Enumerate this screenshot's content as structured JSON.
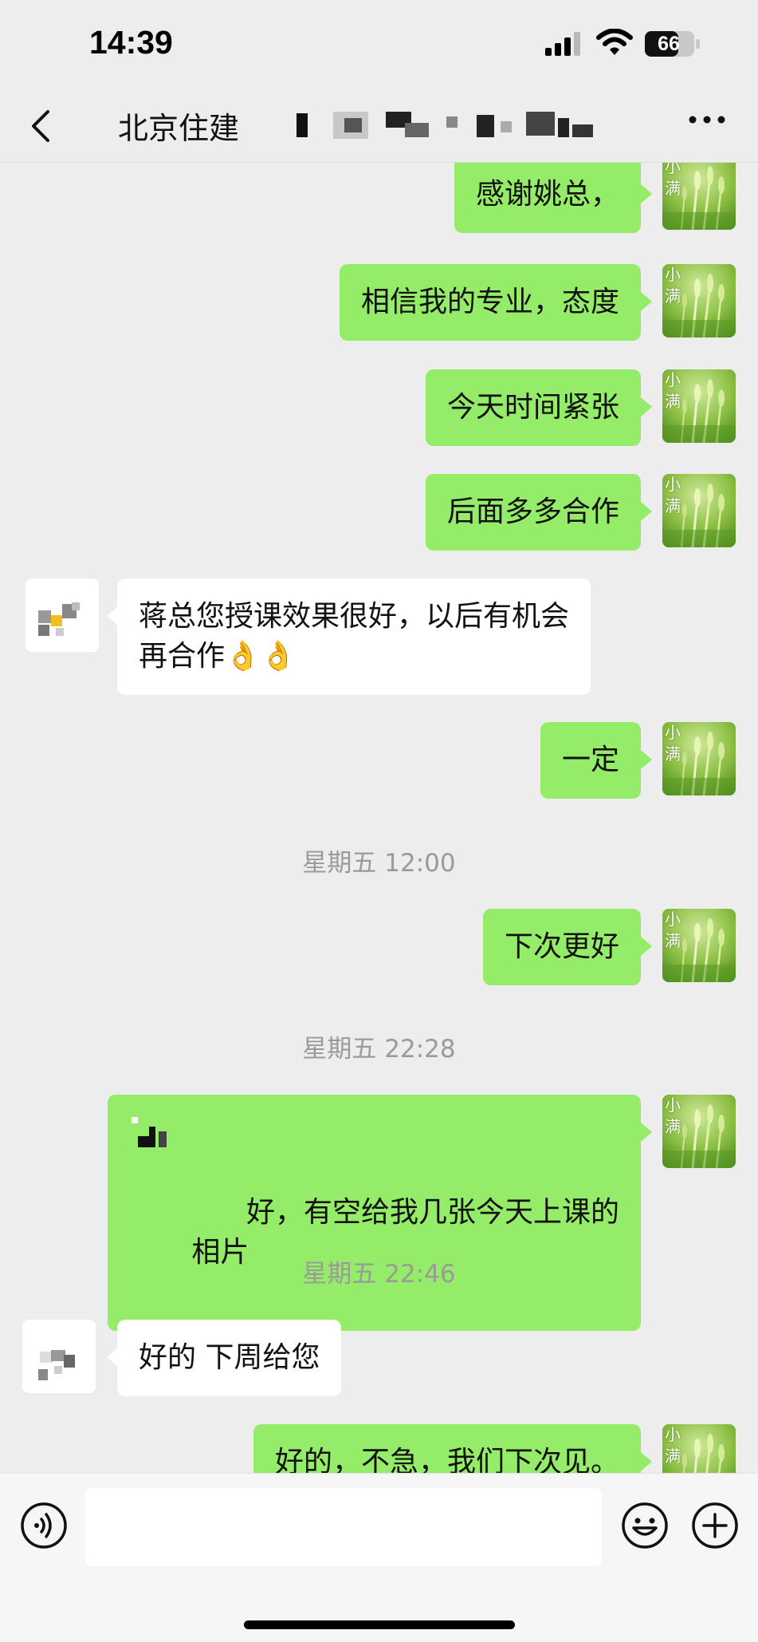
{
  "status_bar": {
    "time": "14:39",
    "battery": "66",
    "icons": [
      "signal-icon",
      "wifi-icon",
      "battery-icon"
    ]
  },
  "nav": {
    "back_icon": "chevron-left-icon",
    "title": "北京住建",
    "more_icon": "more-dots-icon"
  },
  "self": {
    "avatar_label": "小满"
  },
  "messages": [
    {
      "sender": "self",
      "text": "感谢姚总，"
    },
    {
      "sender": "self",
      "text": "相信我的专业，态度"
    },
    {
      "sender": "self",
      "text": "今天时间紧张"
    },
    {
      "sender": "self",
      "text": "后面多多合作"
    },
    {
      "sender": "other",
      "text": "蒋总您授课效果很好，以后有机会\n再合作👌👌"
    },
    {
      "sender": "self",
      "text": "一定"
    },
    {
      "type": "time",
      "text": "星期五 12:00"
    },
    {
      "sender": "self",
      "text": "下次更好"
    },
    {
      "type": "time",
      "text": "星期五 22:28"
    },
    {
      "sender": "self",
      "text": "好，有空给我几张今天上课的\n相片"
    },
    {
      "type": "time",
      "text": "星期五 22:46"
    },
    {
      "sender": "other",
      "text": "好的 下周给您"
    },
    {
      "sender": "self",
      "text": "好的，不急，我们下次见。"
    }
  ],
  "input_bar": {
    "voice_icon": "voice-icon",
    "emoji_icon": "emoji-icon",
    "plus_icon": "plus-icon",
    "input_value": ""
  },
  "colors": {
    "background": "#ededed",
    "self_bubble": "#95ec69",
    "other_bubble": "#ffffff",
    "timestamp_text": "#9a9a9a"
  }
}
